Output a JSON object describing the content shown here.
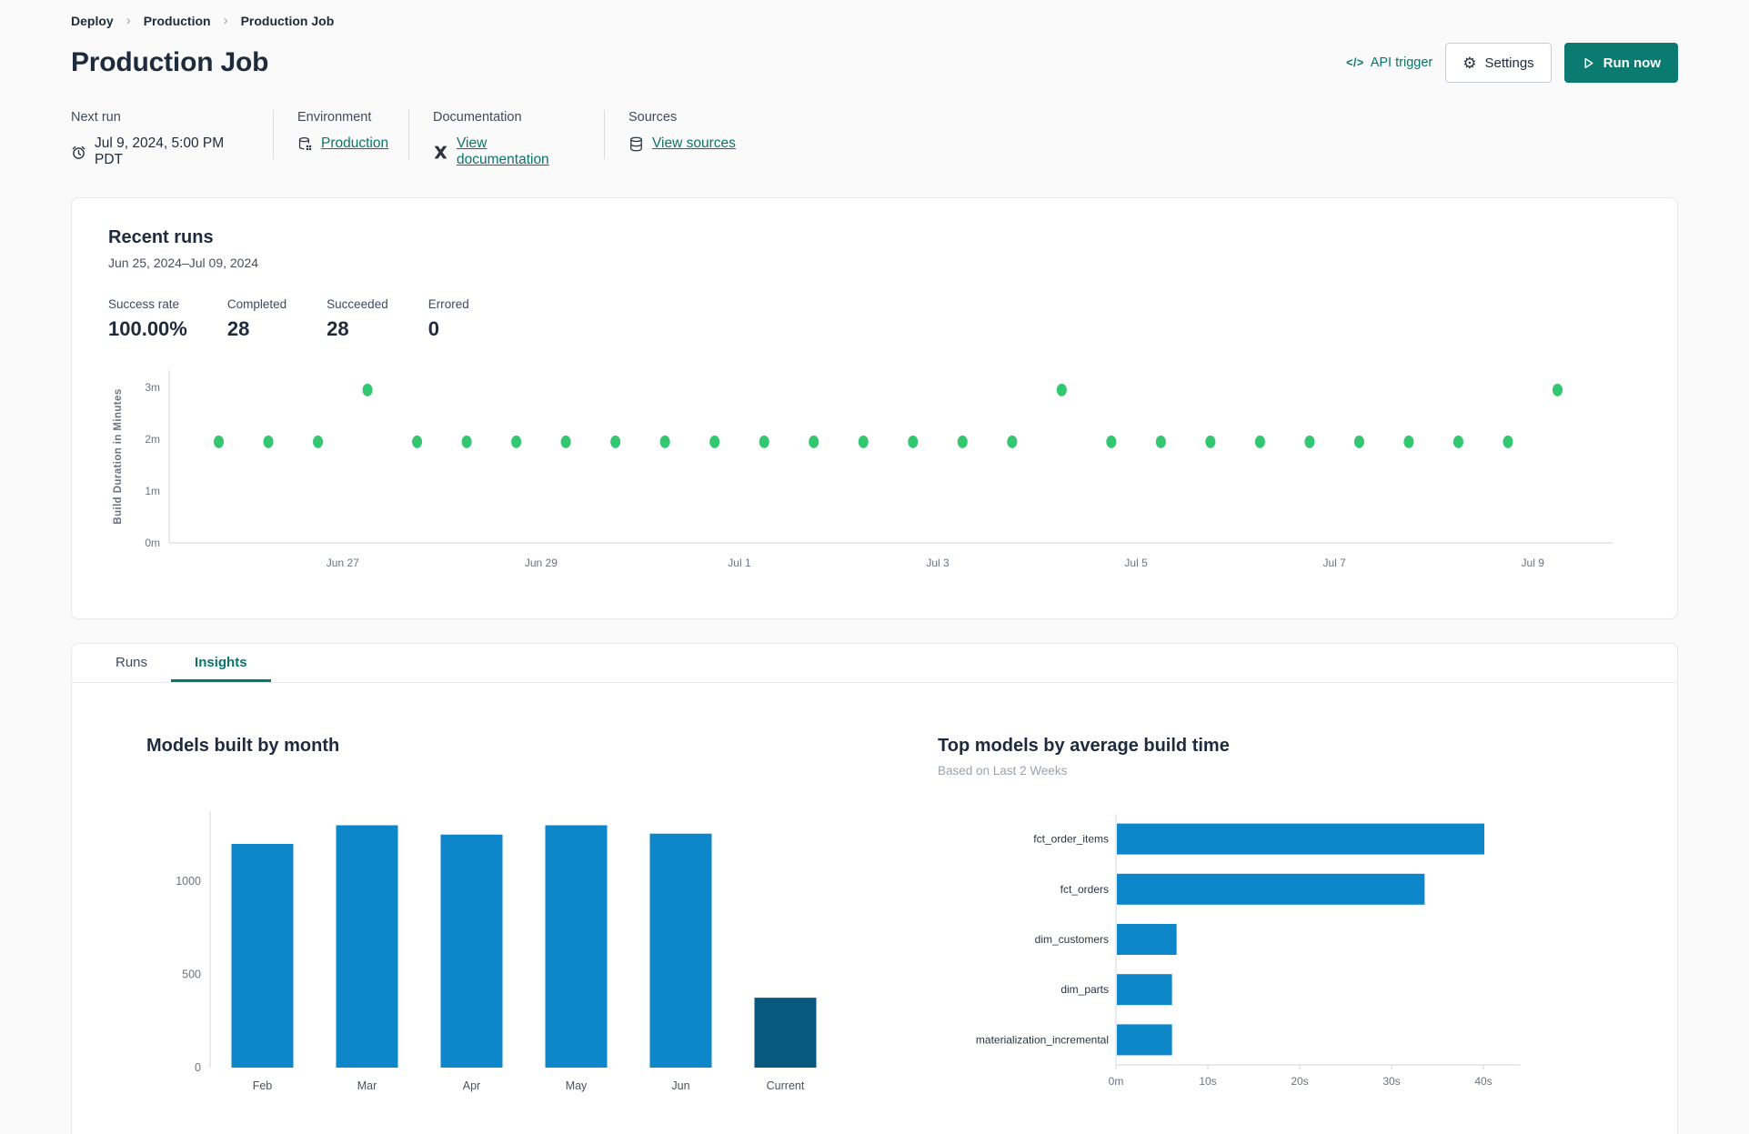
{
  "breadcrumb": {
    "separator": "›",
    "items": [
      {
        "label": "Deploy"
      },
      {
        "label": "Production"
      },
      {
        "label": "Production Job"
      }
    ]
  },
  "header": {
    "title": "Production Job",
    "api_trigger": {
      "icon_glyph": "</>",
      "label": "API trigger"
    },
    "settings": {
      "icon_glyph": "⚙",
      "label": "Settings"
    },
    "run_now": {
      "label": "Run now"
    }
  },
  "info": {
    "next_run": {
      "label": "Next run",
      "value": "Jul 9, 2024, 5:00 PM PDT"
    },
    "environment": {
      "label": "Environment",
      "value": "Production"
    },
    "documentation": {
      "label": "Documentation",
      "value": "View documentation"
    },
    "sources": {
      "label": "Sources",
      "value": "View sources"
    }
  },
  "recent_runs": {
    "title": "Recent runs",
    "date_range": "Jun 25, 2024–Jul 09, 2024",
    "stats": [
      {
        "label": "Success rate",
        "value": "100.00%"
      },
      {
        "label": "Completed",
        "value": "28"
      },
      {
        "label": "Succeeded",
        "value": "28"
      },
      {
        "label": "Errored",
        "value": "0"
      }
    ]
  },
  "tabs": [
    {
      "label": "Runs",
      "active": false
    },
    {
      "label": "Insights",
      "active": true
    }
  ],
  "colors": {
    "accent_teal": "#0a756b",
    "button_teal": "#0b7a70",
    "dot_green": "#33c771",
    "bar_blue": "#0d87c9",
    "bar_dark_blue": "#07597e",
    "axis_gray": "#dfe3e8",
    "tick_text": "#6a7380"
  },
  "chart_data": [
    {
      "id": "build-duration-scatter",
      "type": "scatter",
      "ylabel": "Build Duration in Minutes",
      "yticks": [
        {
          "label": "0m",
          "value": 0
        },
        {
          "label": "1m",
          "value": 1
        },
        {
          "label": "2m",
          "value": 2
        },
        {
          "label": "3m",
          "value": 3
        }
      ],
      "ylim": [
        0,
        3.3
      ],
      "x_tick_labels": [
        "Jun 27",
        "Jun 29",
        "Jul 1",
        "Jul 3",
        "Jul 5",
        "Jul 7",
        "Jul 9"
      ],
      "x_tick_positions": [
        2.5,
        6.5,
        10.5,
        14.5,
        18.5,
        22.5,
        26.5
      ],
      "points_minutes": [
        1.95,
        1.95,
        1.95,
        2.95,
        1.95,
        1.95,
        1.95,
        1.95,
        1.95,
        1.95,
        1.95,
        1.95,
        1.95,
        1.95,
        1.95,
        1.95,
        1.95,
        2.95,
        1.95,
        1.95,
        1.95,
        1.95,
        1.95,
        1.95,
        1.95,
        1.95,
        1.95,
        2.95
      ]
    },
    {
      "id": "models-built-by-month",
      "type": "bar",
      "title": "Models built by month",
      "categories": [
        "Feb",
        "Mar",
        "Apr",
        "May",
        "Jun",
        "Current"
      ],
      "values": [
        1200,
        1300,
        1250,
        1300,
        1255,
        375
      ],
      "highlight_category": "Current",
      "yticks": [
        0,
        500,
        1000
      ],
      "ylim": [
        0,
        1380
      ]
    },
    {
      "id": "top-models-by-build-time",
      "type": "hbar",
      "title": "Top models by average build time",
      "subtitle": "Based on Last 2 Weeks",
      "categories": [
        "fct_order_items",
        "fct_orders",
        "dim_customers",
        "dim_parts",
        "materialization_incremental"
      ],
      "values_seconds": [
        40,
        33.5,
        6.5,
        6,
        6
      ],
      "xticks": [
        {
          "label": "0m",
          "value": 0
        },
        {
          "label": "10s",
          "value": 10
        },
        {
          "label": "20s",
          "value": 20
        },
        {
          "label": "30s",
          "value": 30
        },
        {
          "label": "40s",
          "value": 40
        }
      ],
      "xlim": [
        0,
        44
      ]
    }
  ]
}
